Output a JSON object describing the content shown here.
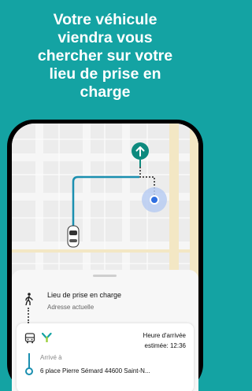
{
  "headline": {
    "line1": "Votre véhicule",
    "line2": "viendra vous",
    "line3": "chercher sur votre",
    "line4": "lieu de prise en",
    "line5": "charge"
  },
  "pickup": {
    "title": "Lieu de prise en charge",
    "subtitle": "Adresse actuelle"
  },
  "trip": {
    "eta_label": "Heure d'arrivée",
    "eta_time": "estimée: 12:36",
    "arrive_label": "Arrivé à",
    "arrive_address": "6 place Pierre Sémard 44600 Saint-N..."
  },
  "colors": {
    "background": "#14a3a3",
    "route": "#1a8fb0",
    "pin": "#0d8a7e",
    "user_dot": "#2f6fe0"
  },
  "icons": [
    "arrow-up-icon",
    "walk-icon",
    "bus-icon",
    "brand-logo-icon",
    "car-icon"
  ]
}
